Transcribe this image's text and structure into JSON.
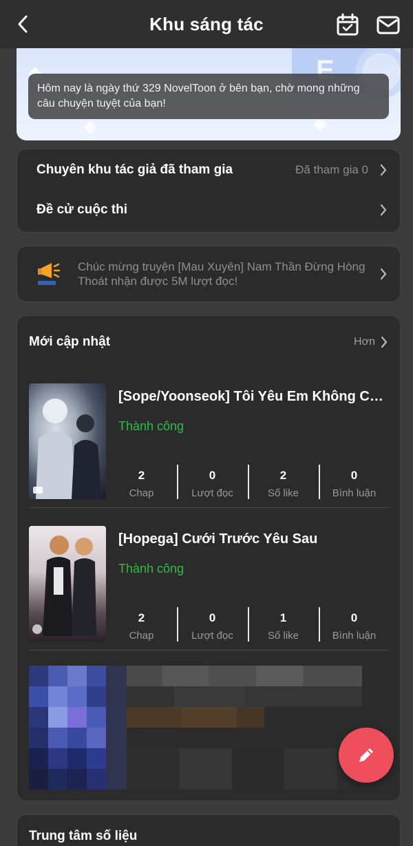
{
  "header": {
    "title": "Khu sáng tác",
    "back_icon": "chevron-left-icon",
    "calendar_icon": "calendar-check-icon",
    "mail_icon": "mail-icon"
  },
  "banner": {
    "message": "Hôm nay là ngày thứ 329 NovelToon ở bên bạn, chờ mong những câu chuyện tuyệt của bạn!"
  },
  "menu": {
    "items": [
      {
        "label": "Chuyên khu tác giả đã tham gia",
        "meta": "Đã tham gia 0"
      },
      {
        "label": "Đề cử cuộc thi",
        "meta": ""
      }
    ]
  },
  "notice": {
    "icon": "megaphone-icon",
    "text": "Chúc mừng truyện [Mau Xuyên] Nam Thần Đừng Hòng Thoát nhận được 5M lượt đọc!"
  },
  "updates": {
    "title": "Mới cập nhật",
    "more_label": "Hơn",
    "stat_labels": [
      "Chap",
      "Lượt đọc",
      "Số like",
      "Bình luận"
    ],
    "books": [
      {
        "title": "[Sope/Yoonseok] Tôi Yêu Em Không Cần...",
        "status": "Thành công",
        "stats": [
          "2",
          "0",
          "2",
          "0"
        ]
      },
      {
        "title": "[Hopega] Cưới Trước Yêu Sau",
        "status": "Thành công",
        "stats": [
          "2",
          "0",
          "1",
          "0"
        ]
      }
    ]
  },
  "data_center": {
    "title": "Trung tâm số liệu"
  },
  "fab": {
    "icon": "pencil-icon"
  },
  "colors": {
    "background": "#3b3b3b",
    "card": "#2b2b2b",
    "success": "#2fbd45",
    "fab": "#ef4f5d"
  }
}
